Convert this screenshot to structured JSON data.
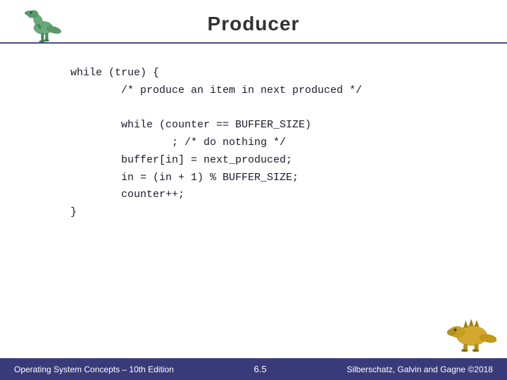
{
  "header": {
    "title": "Producer"
  },
  "code": {
    "line1": "while (true) {",
    "line2": "        /* produce an item in next produced */",
    "line3": "",
    "line4": "        while (counter == BUFFER_SIZE)",
    "line5": "                ; /* do nothing */",
    "line6": "        buffer[in] = next_produced;",
    "line7": "        in = (in + 1) % BUFFER_SIZE;",
    "line8": "        counter++;",
    "line9": "}",
    "full": "while (true) {\n        /* produce an item in next produced */\n\n        while (counter == BUFFER_SIZE)\n                ; /* do nothing */\n        buffer[in] = next_produced;\n        in = (in + 1) % BUFFER_SIZE;\n        counter++;\n}"
  },
  "footer": {
    "left": "Operating System Concepts – 10th Edition",
    "center": "6.5",
    "right": "Silberschatz, Galvin and Gagne ©2018"
  },
  "icons": {
    "dino_top": "raptor",
    "dino_bottom": "ankylosaur"
  }
}
